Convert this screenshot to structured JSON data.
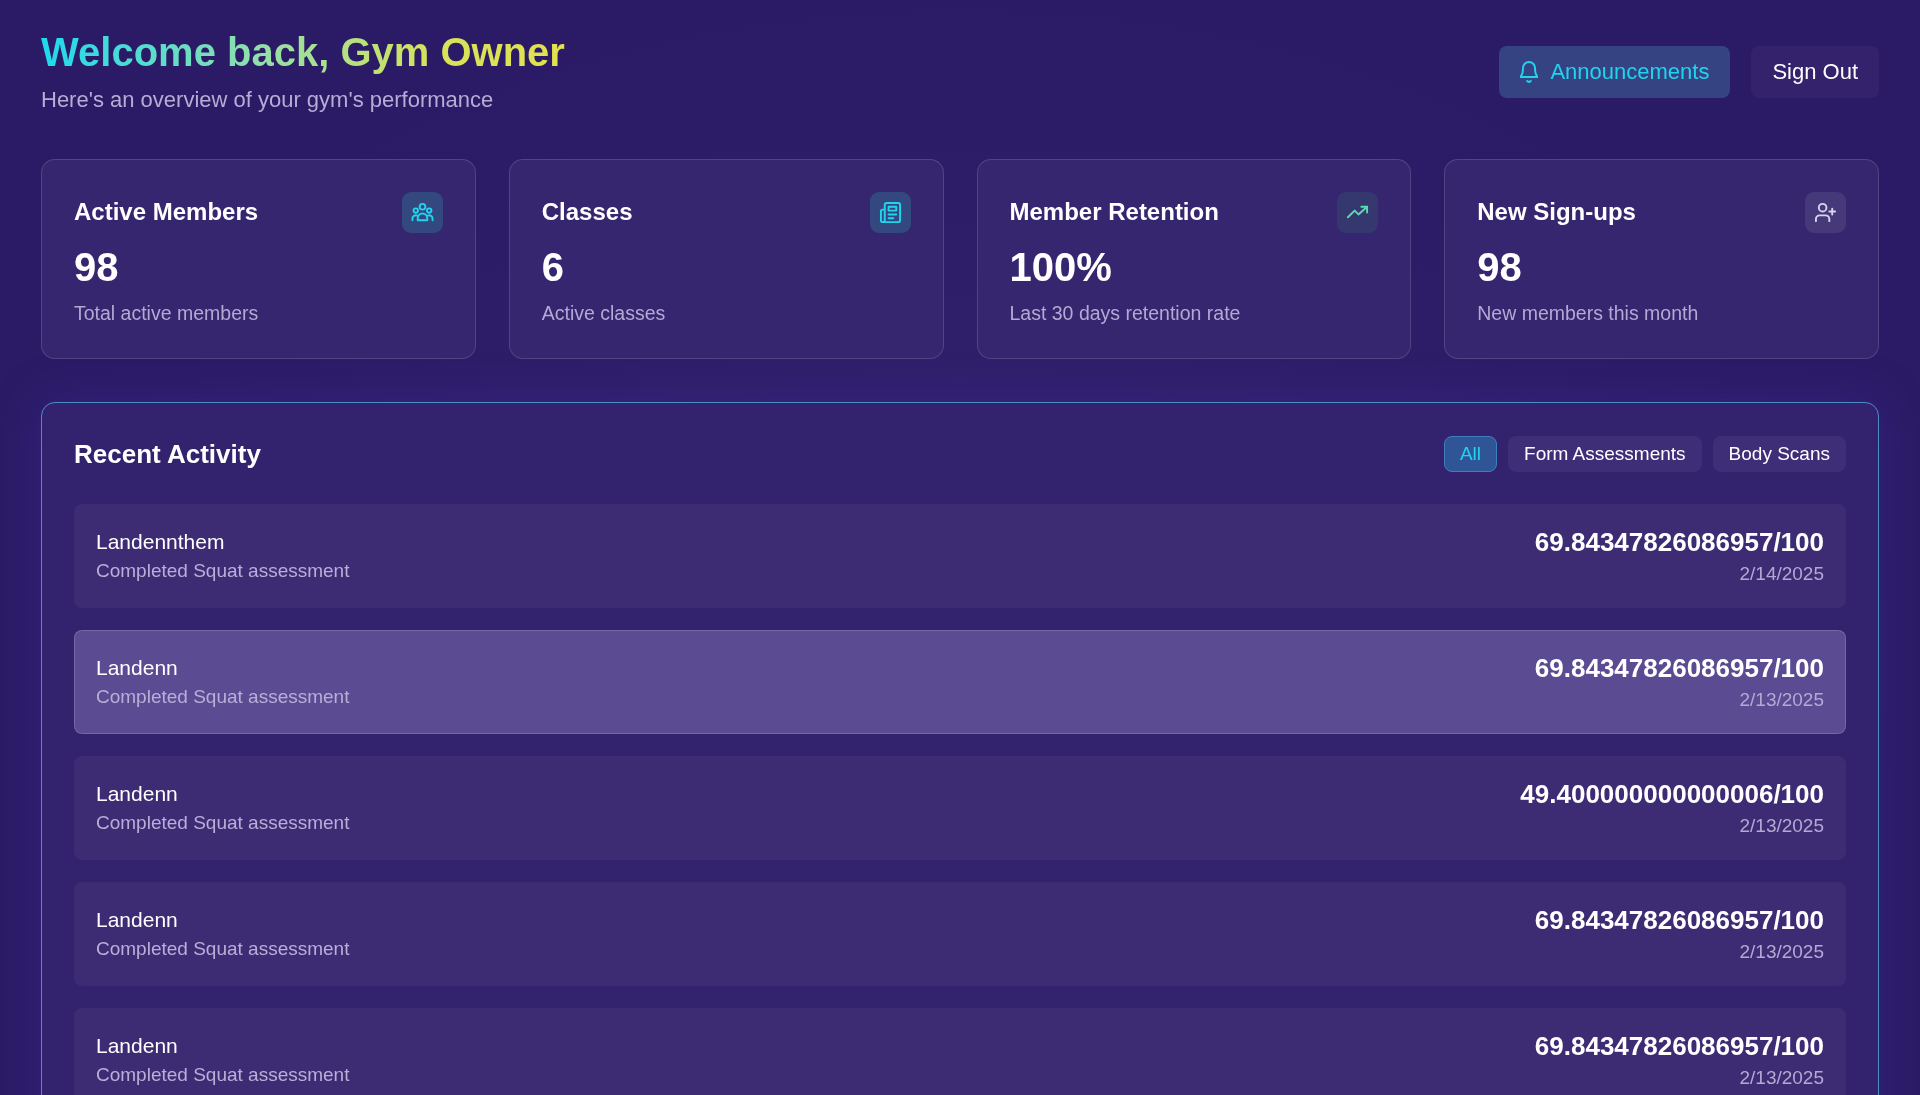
{
  "header": {
    "title": "Welcome back, Gym Owner",
    "subtitle": "Here's an overview of your gym's performance"
  },
  "actions": [
    {
      "kind": "announcements",
      "label": "Announcements"
    },
    {
      "kind": "plain",
      "label": "Sign Out"
    }
  ],
  "stats": [
    {
      "kind": "members",
      "title": "Active Members",
      "value": "98",
      "caption": "Total active members"
    },
    {
      "kind": "classes",
      "title": "Classes",
      "value": "6",
      "caption": "Active classes"
    },
    {
      "kind": "retention",
      "title": "Member Retention",
      "value": "100%",
      "caption": "Last 30 days retention rate"
    },
    {
      "kind": "signups",
      "title": "New Sign-ups",
      "value": "98",
      "caption": "New members this month"
    }
  ],
  "recent_activity": {
    "title": "Recent Activity",
    "filters": [
      {
        "label": "All",
        "selected": true
      },
      {
        "label": "Form Assessments",
        "selected": false
      },
      {
        "label": "Body Scans",
        "selected": false
      }
    ],
    "items": [
      {
        "name": "Landennthem",
        "detail": "Completed Squat assessment",
        "score": "69.84347826086957/100",
        "date": "2/14/2025",
        "hovered": false
      },
      {
        "name": "Landenn",
        "detail": "Completed Squat assessment",
        "score": "69.84347826086957/100",
        "date": "2/13/2025",
        "hovered": true
      },
      {
        "name": "Landenn",
        "detail": "Completed Squat assessment",
        "score": "49.400000000000006/100",
        "date": "2/13/2025",
        "hovered": false
      },
      {
        "name": "Landenn",
        "detail": "Completed Squat assessment",
        "score": "69.84347826086957/100",
        "date": "2/13/2025",
        "hovered": false
      },
      {
        "name": "Landenn",
        "detail": "Completed Squat assessment",
        "score": "69.84347826086957/100",
        "date": "2/13/2025",
        "hovered": false
      }
    ]
  }
}
